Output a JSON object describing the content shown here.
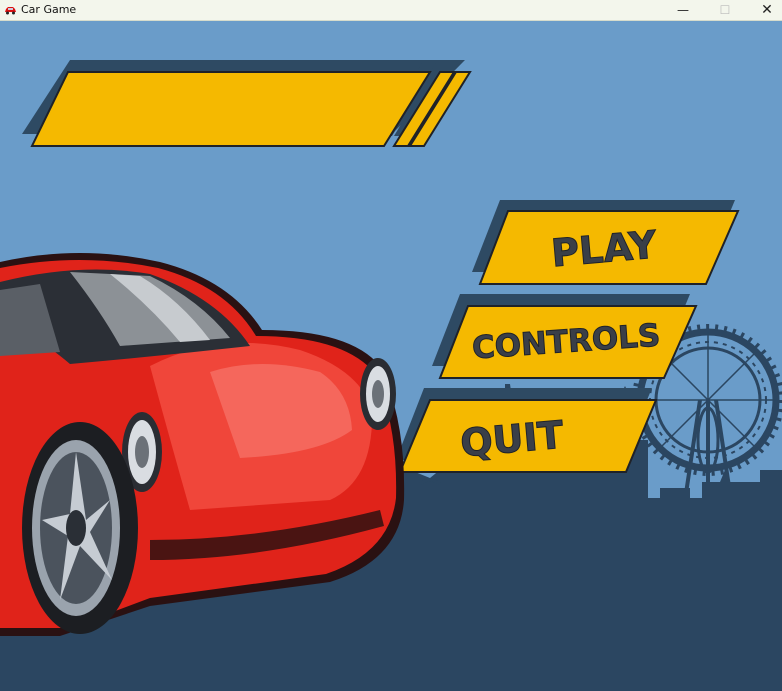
{
  "window": {
    "title": "Car Game",
    "minimize_glyph": "—",
    "maximize_glyph": "☐",
    "close_glyph": "✕"
  },
  "menu": {
    "play_label": "PLAY",
    "controls_label": "CONTROLS",
    "quit_label": "QUIT"
  },
  "colors": {
    "sky": "#6a9cc9",
    "banner_yellow": "#f5b900",
    "banner_shadow": "#2e4a63",
    "skyline": "#2b4661",
    "car_red": "#e0231a"
  },
  "icons": {
    "app": "red-car-icon",
    "minimize": "minimize-icon",
    "maximize": "maximize-icon",
    "close": "close-icon"
  }
}
